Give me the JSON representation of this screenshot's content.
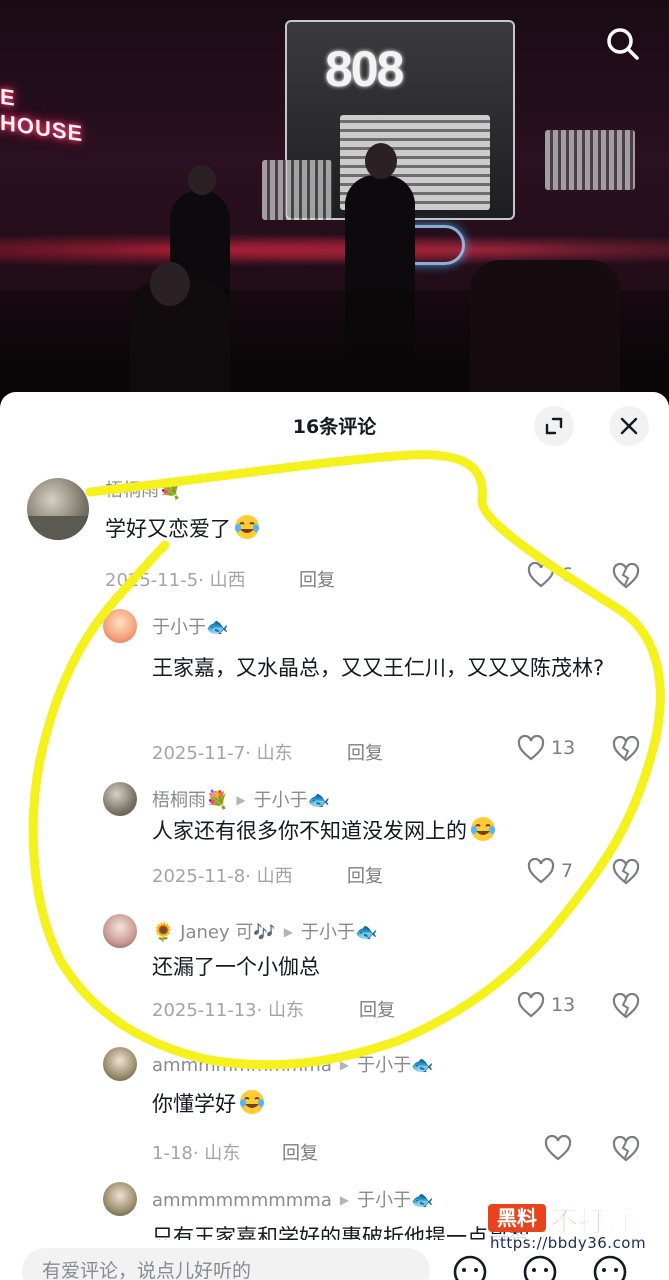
{
  "header": {
    "title": "16条评论"
  },
  "comments": [
    {
      "name": "梧桐雨💐",
      "text": "学好又恋爱了",
      "date_loc": "2025-11-5· 山西",
      "reply_label": "回复",
      "likes": "6"
    },
    {
      "name": "于小于🐟",
      "reply_to": "",
      "text": "王家嘉，又水晶总，又又王仁川，又又又陈茂林?",
      "date_loc": "2025-11-7· 山东",
      "reply_label": "回复",
      "likes": "13"
    },
    {
      "name": "梧桐雨💐",
      "reply_to": "于小于🐟",
      "text": "人家还有很多你不知道没发网上的",
      "date_loc": "2025-11-8· 山西",
      "reply_label": "回复",
      "likes": "7"
    },
    {
      "name": "🌻 Janey 可🎶",
      "reply_to": "于小于🐟",
      "text": "还漏了一个小伽总",
      "date_loc": "2025-11-13· 山东",
      "reply_label": "回复",
      "likes": "13"
    },
    {
      "name": "ammmmmmmmma",
      "reply_to": "于小于🐟",
      "text": "你懂学好",
      "date_loc": "1-18· 山东",
      "reply_label": "回复",
      "likes": ""
    },
    {
      "name": "ammmmmmmmma",
      "reply_to": "于小于🐟",
      "text": "只有王家嘉和学好的惠破折他提一点哥智"
    }
  ],
  "input": {
    "placeholder": "有爱评论，说点儿好听的"
  },
  "video": {
    "sign_text": "E HOUSE",
    "screen_text": "808"
  },
  "watermark": {
    "badge": "黑料",
    "text": "不打烊",
    "url": "https://bbdy36.com"
  },
  "colors": {
    "highlight": "#f4f11c",
    "text_primary": "#161823",
    "text_secondary": "#8a8b91"
  }
}
